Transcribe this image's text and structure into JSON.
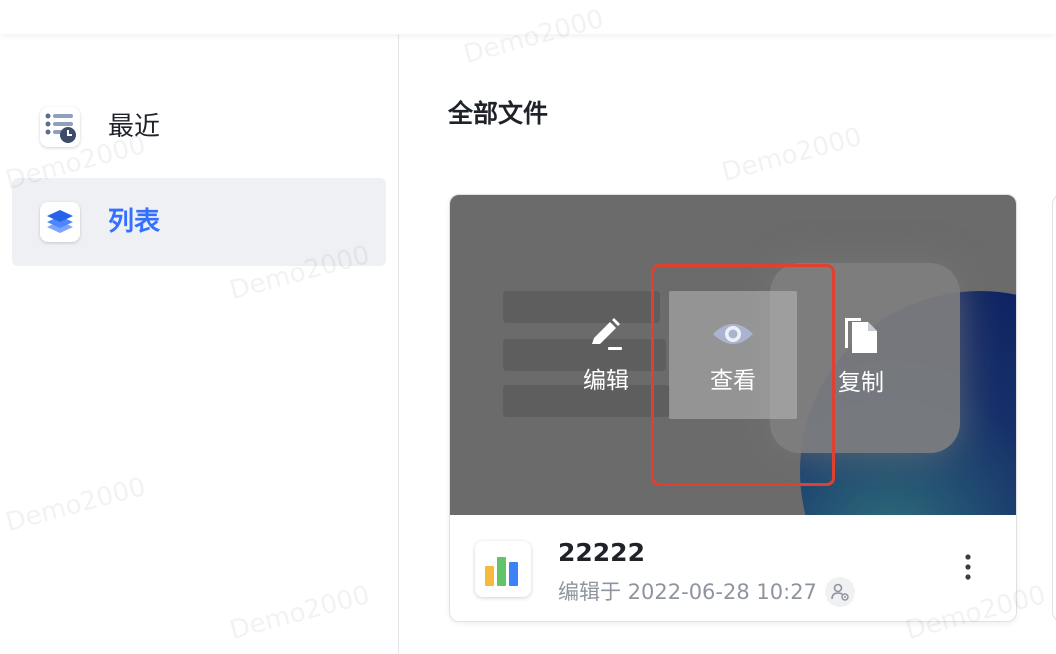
{
  "sidebar": {
    "items": [
      {
        "label": "最近",
        "icon": "recent-list-clock-icon",
        "active": false
      },
      {
        "label": "列表",
        "icon": "layers-icon",
        "active": true
      }
    ]
  },
  "main": {
    "title": "全部文件",
    "card": {
      "actions": [
        {
          "label": "编辑",
          "icon": "pencil-icon"
        },
        {
          "label": "查看",
          "icon": "eye-icon"
        },
        {
          "label": "复制",
          "icon": "copy-icon"
        }
      ],
      "file_name": "22222",
      "file_meta": "编辑于 2022-06-28 10:27",
      "file_icon": "bar-chart-file-icon"
    }
  },
  "watermark": "Demo2000",
  "colors": {
    "accent": "#3370ff",
    "highlight": "#e0402f",
    "cover_overlay": "#6b6b6b"
  }
}
